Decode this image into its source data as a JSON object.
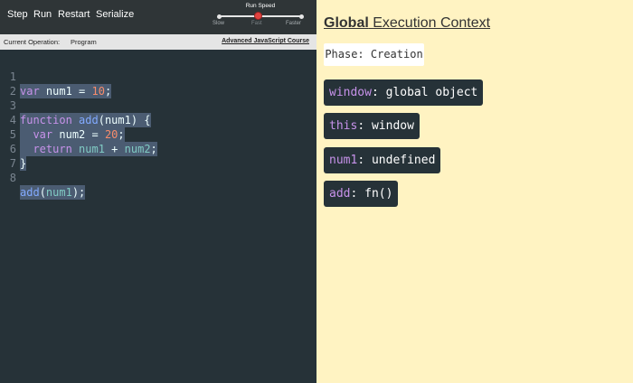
{
  "toolbar": {
    "step_label": "Step",
    "run_label": "Run",
    "restart_label": "Restart",
    "serialize_label": "Serialize",
    "speed": {
      "title": "Run Speed",
      "labels": [
        "Slow",
        "Fast",
        "Faster"
      ],
      "selected": "Fast"
    }
  },
  "operation_bar": {
    "label": "Current Operation:",
    "value": "Program",
    "link": "Advanced JavaScript Course"
  },
  "editor": {
    "line_numbers": [
      "1",
      "2",
      "3",
      "4",
      "5",
      "6",
      "7",
      "8"
    ],
    "lines": [
      "var num1 = 10;",
      "",
      "function add(num1) {",
      "  var num2 = 20;",
      "  return num1 + num2;",
      "}",
      "",
      "add(num1);"
    ],
    "highlighted_lines": [
      1,
      3,
      4,
      5,
      6,
      8
    ]
  },
  "context": {
    "title_bold": "Global",
    "title_rest": " Execution Context",
    "phase": "Phase: Creation",
    "entries": [
      {
        "key": "window",
        "value": ": global object"
      },
      {
        "key": "this",
        "value": ": window"
      },
      {
        "key": "num1",
        "value": ": undefined"
      },
      {
        "key": "add",
        "value": ": fn()"
      }
    ]
  },
  "colors": {
    "editor_bg": "#263238",
    "context_bg": "#fff3c2",
    "keyword": "#c792ea",
    "number": "#f78c6c",
    "variable": "#80cbc4",
    "function": "#82aaff",
    "speed_knob": "#e0423f"
  }
}
